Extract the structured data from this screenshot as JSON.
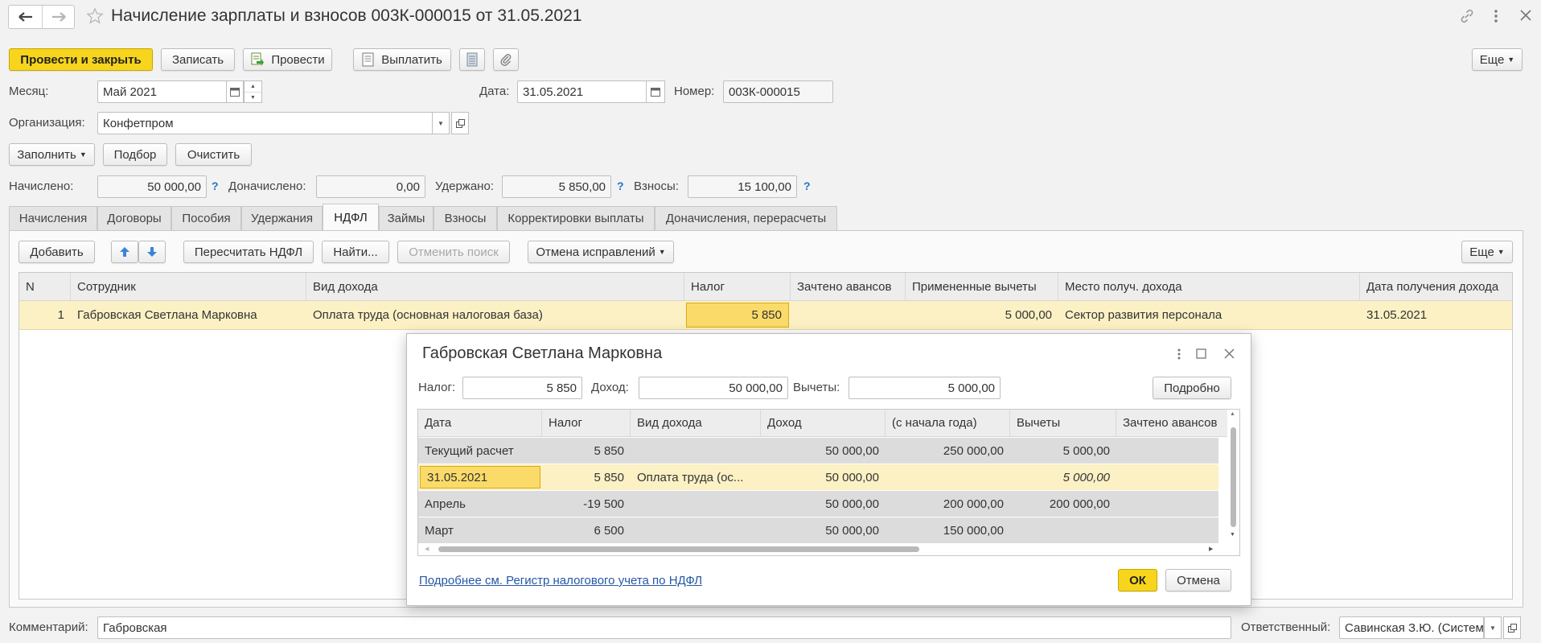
{
  "title": "Начисление зарплаты и взносов 003К-000015 от 31.05.2021",
  "toolbar": {
    "post_close": "Провести и закрыть",
    "save": "Записать",
    "post": "Провести",
    "pay": "Выплатить",
    "more": "Еще"
  },
  "fields": {
    "month_label": "Месяц:",
    "month_value": "Май 2021",
    "date_label": "Дата:",
    "date_value": "31.05.2021",
    "number_label": "Номер:",
    "number_value": "003К-000015",
    "org_label": "Организация:",
    "org_value": "Конфетпром"
  },
  "fill_bar": {
    "fill": "Заполнить",
    "select": "Подбор",
    "clear": "Очистить"
  },
  "totals": {
    "accrued_label": "Начислено:",
    "accrued_value": "50 000,00",
    "extra_label": "Доначислено:",
    "extra_value": "0,00",
    "withheld_label": "Удержано:",
    "withheld_value": "5 850,00",
    "contrib_label": "Взносы:",
    "contrib_value": "15 100,00",
    "help": "?"
  },
  "tabs": [
    "Начисления",
    "Договоры",
    "Пособия",
    "Удержания",
    "НДФЛ",
    "Займы",
    "Взносы",
    "Корректировки выплаты",
    "Доначисления, перерасчеты"
  ],
  "tab_toolbar": {
    "add": "Добавить",
    "recalc": "Пересчитать НДФЛ",
    "find": "Найти...",
    "cancel_search": "Отменить поиск",
    "cancel_fix": "Отмена исправлений",
    "more": "Еще"
  },
  "table": {
    "headers": [
      "N",
      "Сотрудник",
      "Вид дохода",
      "Налог",
      "Зачтено авансов",
      "Примененные вычеты",
      "Место получ. дохода",
      "Дата получения дохода"
    ],
    "row": [
      "1",
      "Габровская Светлана Марковна",
      "Оплата труда (основная налоговая база)",
      "5 850",
      "",
      "5 000,00",
      "Сектор развития персонала",
      "31.05.2021"
    ]
  },
  "dialog": {
    "title": "Габровская Светлана Марковна",
    "tax_label": "Налог:",
    "tax_value": "5 850",
    "income_label": "Доход:",
    "income_value": "50 000,00",
    "deductions_label": "Вычеты:",
    "deductions_value": "5 000,00",
    "details": "Подробно",
    "headers": [
      "Дата",
      "Налог",
      "Вид дохода",
      "Доход",
      "(с начала года)",
      "Вычеты",
      "Зачтено авансов"
    ],
    "rows": [
      [
        "Текущий расчет",
        "5 850",
        "",
        "50 000,00",
        "250 000,00",
        "5 000,00",
        ""
      ],
      [
        "31.05.2021",
        "5 850",
        "Оплата труда (ос...",
        "50 000,00",
        "",
        "5 000,00",
        ""
      ],
      [
        "Апрель",
        "-19 500",
        "",
        "50 000,00",
        "200 000,00",
        "200 000,00",
        ""
      ],
      [
        "Март",
        "6 500",
        "",
        "50 000,00",
        "150 000,00",
        "",
        ""
      ]
    ],
    "link": "Подробнее см. Регистр налогового учета по НДФЛ",
    "ok": "ОК",
    "cancel": "Отмена"
  },
  "footer": {
    "comment_label": "Комментарий:",
    "comment_value": "Габровская",
    "responsible_label": "Ответственный:",
    "responsible_value": "Савинская З.Ю. (Систем"
  }
}
